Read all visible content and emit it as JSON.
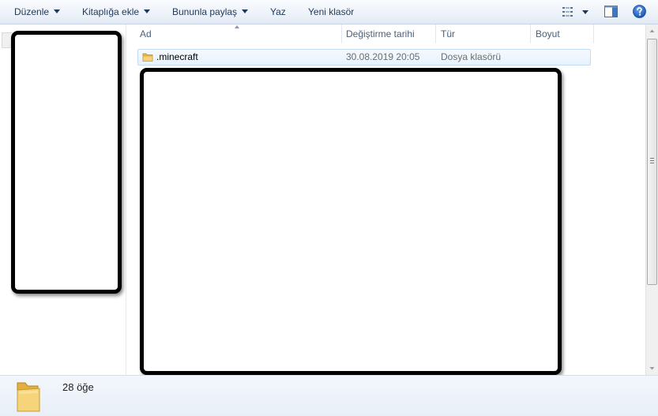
{
  "toolbar": {
    "organize_label": "Düzenle",
    "add_to_library_label": "Kitaplığa ekle",
    "share_with_label": "Bununla paylaş",
    "burn_label": "Yaz",
    "new_folder_label": "Yeni klasör",
    "icons": [
      "view-options-icon",
      "preview-pane-icon",
      "help-icon"
    ]
  },
  "file_list": {
    "columns": [
      {
        "key": "name",
        "label": "Ad"
      },
      {
        "key": "modified",
        "label": "Değiştirme tarihi"
      },
      {
        "key": "type",
        "label": "Tür"
      },
      {
        "key": "size",
        "label": "Boyut"
      }
    ],
    "sort_column": "name",
    "rows": [
      {
        "name": ".minecraft",
        "modified": "30.08.2019 20:05",
        "type": "Dosya klasörü",
        "size": "",
        "icon": "folder-icon"
      }
    ]
  },
  "status": {
    "item_count": "28 öğe",
    "icon": "folder-icon"
  },
  "colors": {
    "toolbar_text": "#1e395b",
    "selection_border": "#c2dcf5",
    "redaction": "#000000"
  }
}
